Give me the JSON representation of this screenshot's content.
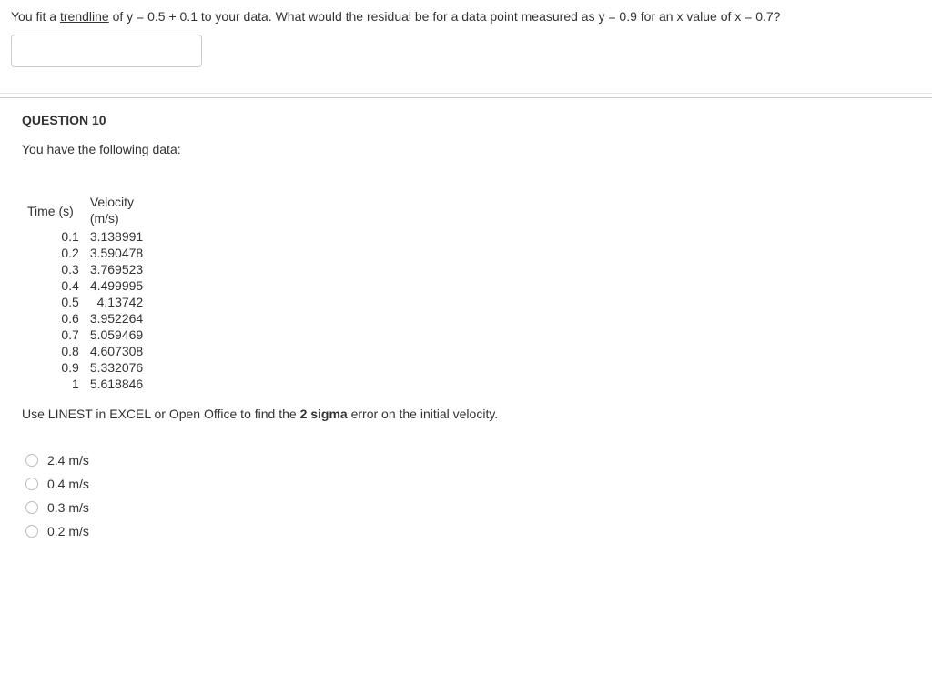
{
  "top_question": {
    "prefix": "You fit a ",
    "trendline_word": "trendline",
    "suffix": " of y = 0.5 + 0.1 to your data. What would the residual be for a data point measured as y = 0.9 for an x value of x = 0.7?",
    "input_value": ""
  },
  "q10": {
    "header": "QUESTION 10",
    "intro": "You have the following data:",
    "table": {
      "col1_header": "Time (s)",
      "col2_header_line1": "Velocity",
      "col2_header_line2": "(m/s)",
      "rows": [
        {
          "time": "0.1",
          "velocity": "3.138991"
        },
        {
          "time": "0.2",
          "velocity": "3.590478"
        },
        {
          "time": "0.3",
          "velocity": "3.769523"
        },
        {
          "time": "0.4",
          "velocity": "4.499995"
        },
        {
          "time": "0.5",
          "velocity": "4.13742"
        },
        {
          "time": "0.6",
          "velocity": "3.952264"
        },
        {
          "time": "0.7",
          "velocity": "5.059469"
        },
        {
          "time": "0.8",
          "velocity": "4.607308"
        },
        {
          "time": "0.9",
          "velocity": "5.332076"
        },
        {
          "time": "1",
          "velocity": "5.618846"
        }
      ]
    },
    "instruction_prefix": "Use LINEST in EXCEL or Open Office to find the ",
    "instruction_bold": "2 sigma",
    "instruction_suffix": " error on the initial velocity.",
    "options": [
      {
        "label": "2.4 m/s"
      },
      {
        "label": "0.4 m/s"
      },
      {
        "label": "0.3 m/s"
      },
      {
        "label": "0.2 m/s"
      }
    ]
  }
}
